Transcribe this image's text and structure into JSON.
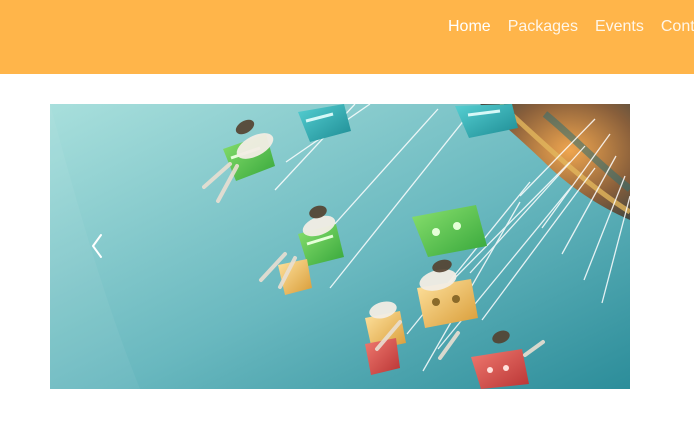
{
  "nav": {
    "items": [
      {
        "label": "Home",
        "active": true
      },
      {
        "label": "Packages",
        "active": false
      },
      {
        "label": "Events",
        "active": false
      },
      {
        "label": "Conta",
        "active": false
      }
    ]
  },
  "colors": {
    "header_bg": "#ffb54a",
    "nav_text": "#ffffff",
    "photo_sky": "#7fc6c8",
    "seat_teal": "#22a7ad",
    "seat_green": "#5dc246",
    "seat_yellow": "#f2c25a",
    "seat_red": "#d94b45"
  },
  "carousel": {
    "prev_icon": "chevron-left-icon"
  }
}
